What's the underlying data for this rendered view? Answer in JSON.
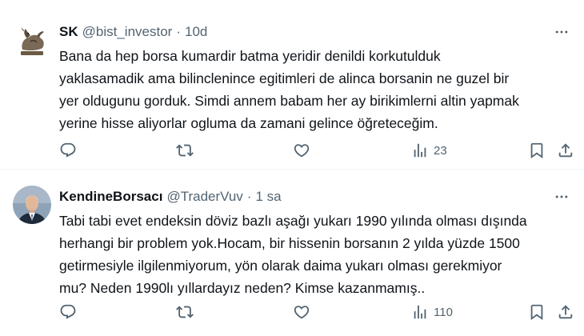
{
  "tweets": [
    {
      "name": "SK",
      "handle": "@bist_investor",
      "separator": "·",
      "time": "10d",
      "text": "Bana da hep borsa kumardir batma yeridir denildi korkutulduk\nyaklasamadik ama bilinclenince egitimleri de alinca borsanin ne guzel bir\nyer oldugunu gorduk. Simdi annem babam her ay birikimlerni altin yapmak\nyerine hisse aliyorlar ogluma da zamani gelince öğreteceğim.",
      "views": "23",
      "avatar_icon": "bronze-bull-statue-avatar"
    },
    {
      "name": "KendineBorsacı",
      "handle": "@TraderVuv",
      "separator": "·",
      "time": "1 sa",
      "text": "Tabi tabi evet endeksin döviz bazlı aşağı yukarı 1990 yılında olması dışında\nherhangi bir problem yok.Hocam, bir hissenin borsanın 2 yılda yüzde 1500\ngetirmesiyle ilgilenmiyorum, yön olarak daima yukarı olması gerekmiyor\nmu? Neden 1990lı yıllardayız neden? Kimse kazanmamış..",
      "views": "110",
      "avatar_icon": "man-in-suit-portrait-avatar"
    }
  ],
  "colors": {
    "text_primary": "#0f1419",
    "text_secondary": "#536471",
    "divider": "#eff3f4",
    "background": "#ffffff"
  },
  "icons": [
    "reply-icon",
    "retweet-icon",
    "like-icon",
    "views-icon",
    "bookmark-icon",
    "share-icon",
    "more-icon"
  ]
}
